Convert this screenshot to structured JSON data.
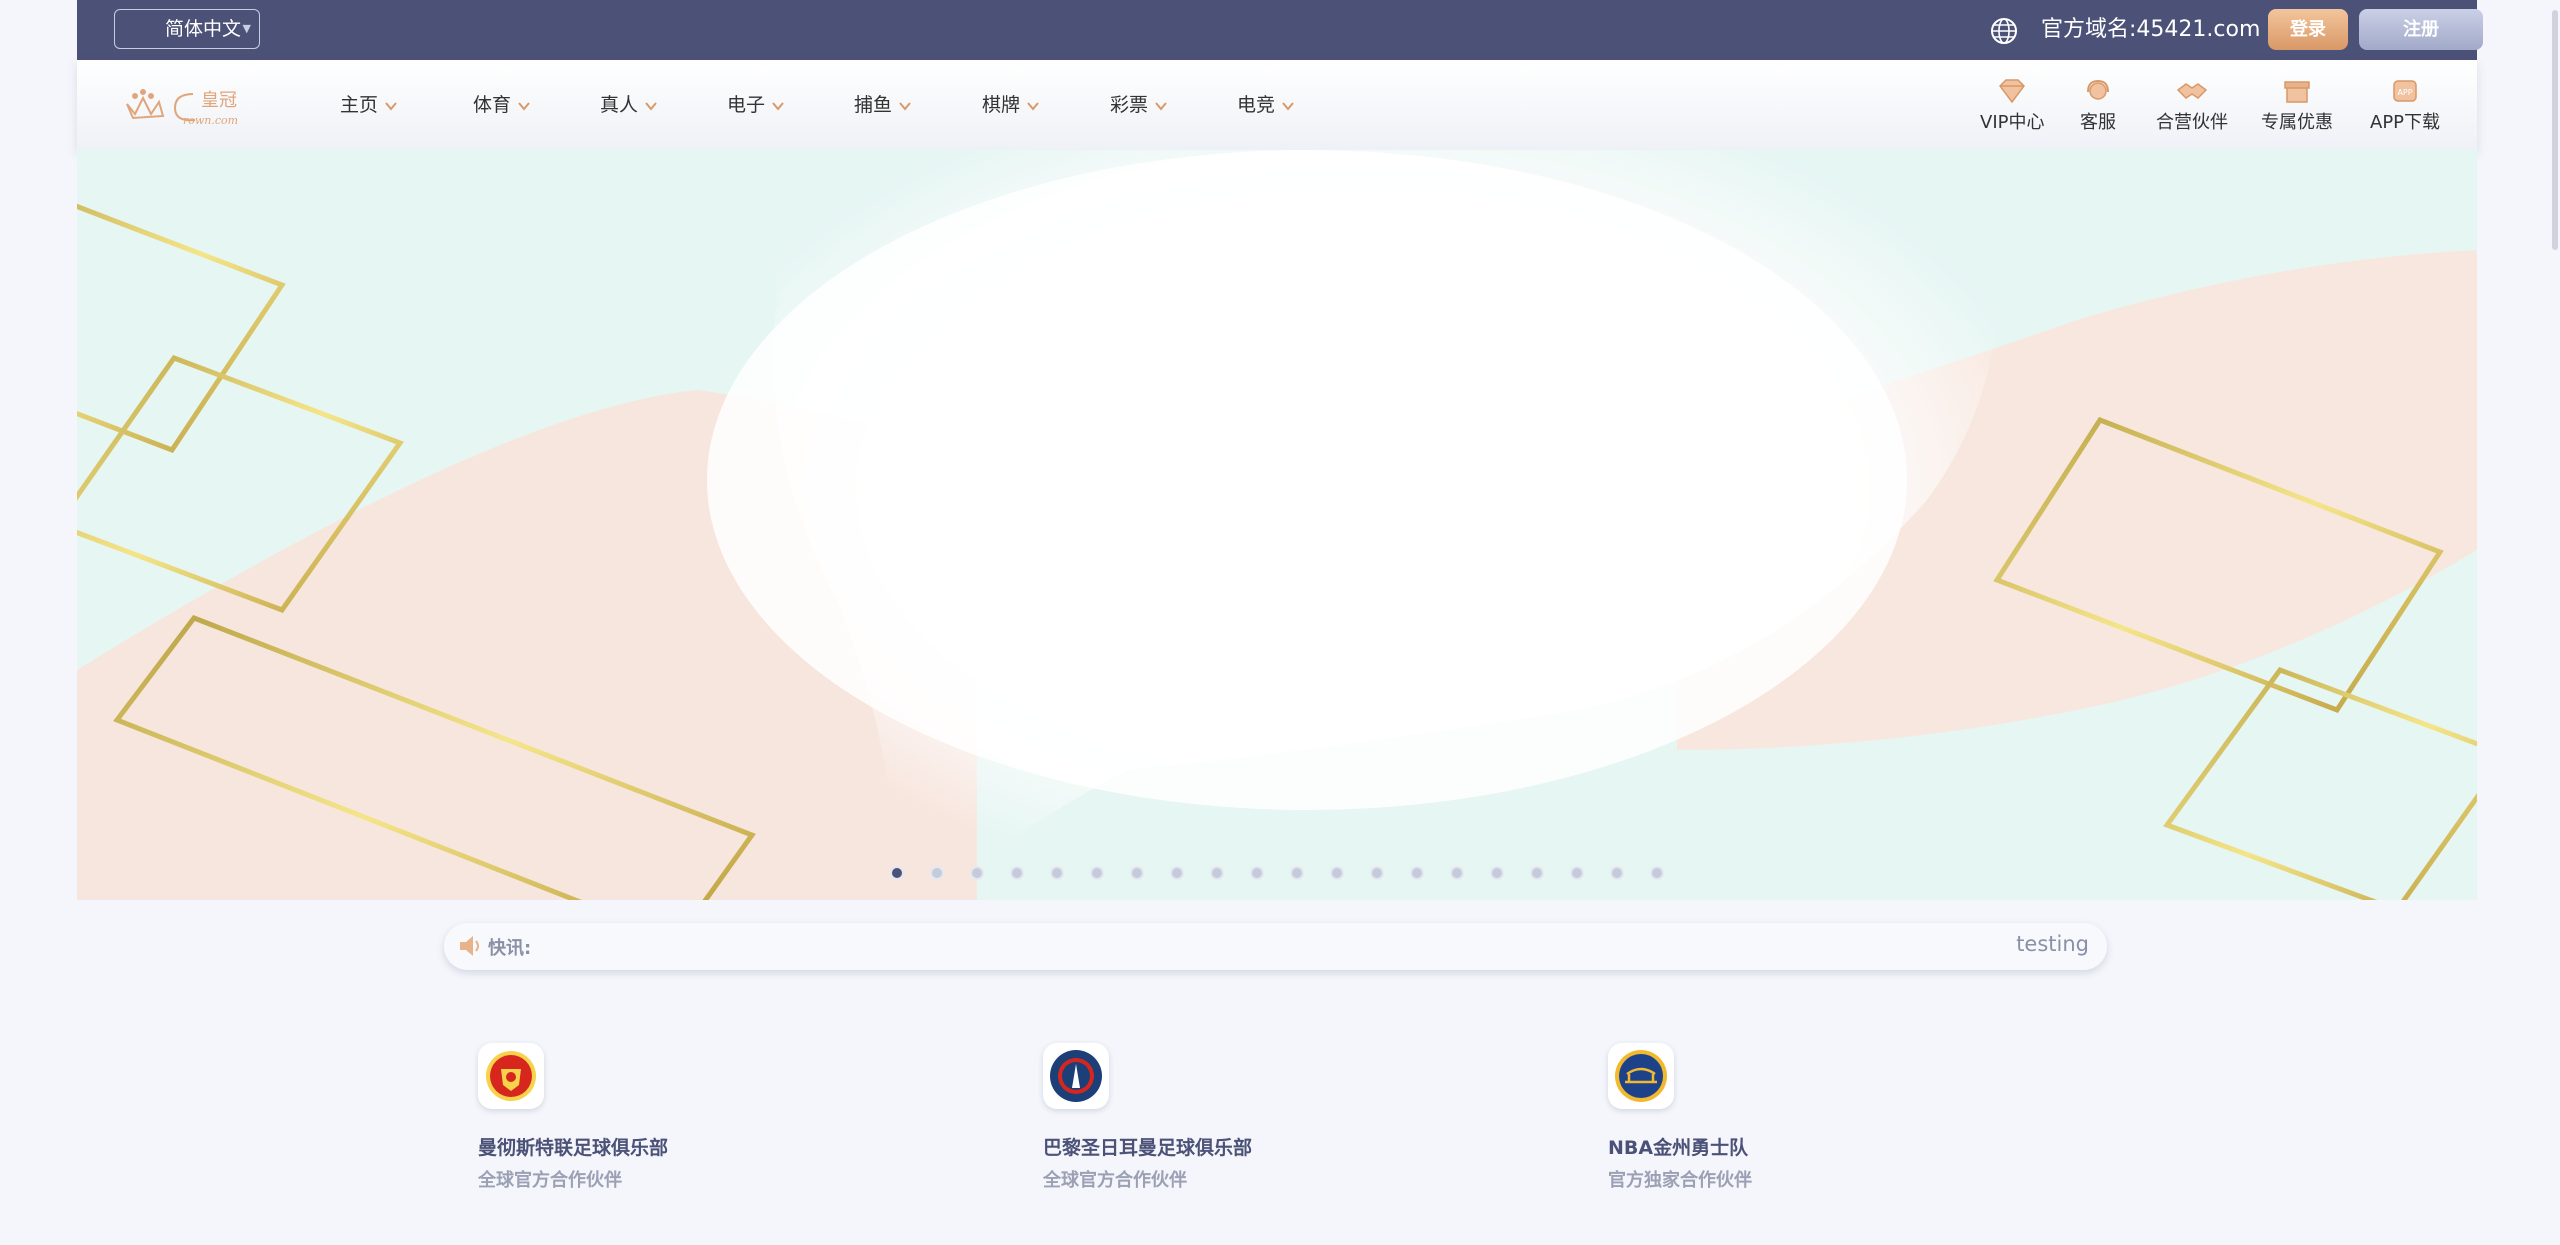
{
  "header": {
    "language": "简体中文",
    "domain_text": "官方域名:45421.com",
    "login": "登录",
    "register": "注册"
  },
  "nav": {
    "logo_text": "皇冠",
    "items": [
      "主页",
      "体育",
      "真人",
      "电子",
      "捕鱼",
      "棋牌",
      "彩票",
      "电竞"
    ],
    "right": [
      "VIP中心",
      "客服",
      "合营伙伴",
      "专属优惠",
      "APP下载"
    ]
  },
  "banner": {
    "slides": 20,
    "active_index": 0
  },
  "ticker": {
    "label": "快讯:",
    "message": "testing"
  },
  "partners": [
    {
      "name": "曼彻斯特联足球俱乐部",
      "sub": "全球官方合作伙伴",
      "icon": "manchester-united-crest-icon"
    },
    {
      "name": "巴黎圣日耳曼足球俱乐部",
      "sub": "全球官方合作伙伴",
      "icon": "psg-crest-icon"
    },
    {
      "name": "NBA金州勇士队",
      "sub": "官方独家合作伙伴",
      "icon": "golden-state-warriors-icon"
    }
  ],
  "colors": {
    "header_bg": "#4b5177",
    "accent": "#d99867",
    "text_muted": "#9ba0b4"
  }
}
